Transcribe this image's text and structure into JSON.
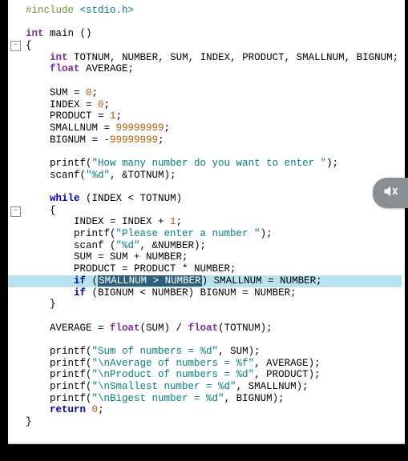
{
  "code": {
    "lines": [
      {
        "indent": 0,
        "tokens": [
          {
            "c": "pp",
            "t": "#include"
          },
          {
            "c": "",
            "t": " "
          },
          {
            "c": "s",
            "t": "<stdio.h>"
          }
        ]
      },
      {
        "indent": 0,
        "tokens": []
      },
      {
        "indent": 0,
        "tokens": [
          {
            "c": "ty",
            "t": "int"
          },
          {
            "c": "",
            "t": " "
          },
          {
            "c": "id",
            "t": "main ()"
          }
        ]
      },
      {
        "indent": 0,
        "tokens": [
          {
            "c": "id",
            "t": "{"
          }
        ]
      },
      {
        "indent": 1,
        "tokens": [
          {
            "c": "ty",
            "t": "int"
          },
          {
            "c": "",
            "t": " "
          },
          {
            "c": "id",
            "t": "TOTNUM, NUMBER, SUM, INDEX, PRODUCT, SMALLNUM, BIGNUM;"
          }
        ]
      },
      {
        "indent": 1,
        "tokens": [
          {
            "c": "ty",
            "t": "float"
          },
          {
            "c": "",
            "t": " "
          },
          {
            "c": "id",
            "t": "AVERAGE;"
          }
        ]
      },
      {
        "indent": 0,
        "tokens": []
      },
      {
        "indent": 1,
        "tokens": [
          {
            "c": "id",
            "t": "SUM = "
          },
          {
            "c": "n",
            "t": "0"
          },
          {
            "c": "id",
            "t": ";"
          }
        ]
      },
      {
        "indent": 1,
        "tokens": [
          {
            "c": "id",
            "t": "INDEX = "
          },
          {
            "c": "n",
            "t": "0"
          },
          {
            "c": "id",
            "t": ";"
          }
        ]
      },
      {
        "indent": 1,
        "tokens": [
          {
            "c": "id",
            "t": "PRODUCT = "
          },
          {
            "c": "n",
            "t": "1"
          },
          {
            "c": "id",
            "t": ";"
          }
        ]
      },
      {
        "indent": 1,
        "tokens": [
          {
            "c": "id",
            "t": "SMALLNUM = "
          },
          {
            "c": "n",
            "t": "99999999"
          },
          {
            "c": "id",
            "t": ";"
          }
        ]
      },
      {
        "indent": 1,
        "tokens": [
          {
            "c": "id",
            "t": "BIGNUM = -"
          },
          {
            "c": "n",
            "t": "99999999"
          },
          {
            "c": "id",
            "t": ";"
          }
        ]
      },
      {
        "indent": 0,
        "tokens": []
      },
      {
        "indent": 1,
        "tokens": [
          {
            "c": "id",
            "t": "printf("
          },
          {
            "c": "s",
            "t": "\"How many number do you want to enter \""
          },
          {
            "c": "id",
            "t": ");"
          }
        ]
      },
      {
        "indent": 1,
        "tokens": [
          {
            "c": "id",
            "t": "scanf("
          },
          {
            "c": "s",
            "t": "\"%d\""
          },
          {
            "c": "id",
            "t": ", &TOTNUM);"
          }
        ]
      },
      {
        "indent": 0,
        "tokens": []
      },
      {
        "indent": 1,
        "tokens": [
          {
            "c": "kw",
            "t": "while"
          },
          {
            "c": "",
            "t": " "
          },
          {
            "c": "id",
            "t": "(INDEX < TOTNUM)"
          }
        ]
      },
      {
        "indent": 1,
        "tokens": [
          {
            "c": "id",
            "t": "{"
          }
        ]
      },
      {
        "indent": 2,
        "tokens": [
          {
            "c": "id",
            "t": "INDEX = INDEX + "
          },
          {
            "c": "n",
            "t": "1"
          },
          {
            "c": "id",
            "t": ";"
          }
        ]
      },
      {
        "indent": 2,
        "tokens": [
          {
            "c": "id",
            "t": "printf("
          },
          {
            "c": "s",
            "t": "\"Please enter a number \""
          },
          {
            "c": "id",
            "t": ");"
          }
        ]
      },
      {
        "indent": 2,
        "tokens": [
          {
            "c": "id",
            "t": "scanf ("
          },
          {
            "c": "s",
            "t": "\"%d\""
          },
          {
            "c": "id",
            "t": ", &NUMBER);"
          }
        ]
      },
      {
        "indent": 2,
        "tokens": [
          {
            "c": "id",
            "t": "SUM = SUM + NUMBER;"
          }
        ]
      },
      {
        "indent": 2,
        "tokens": [
          {
            "c": "id",
            "t": "PRODUCT = PRODUCT * NUMBER;"
          }
        ]
      },
      {
        "indent": 2,
        "hl": true,
        "tokens": [
          {
            "c": "kw",
            "t": "if"
          },
          {
            "c": "",
            "t": " "
          },
          {
            "c": "id",
            "t": "("
          },
          {
            "c": "rev",
            "t": "SMALLNUM > NUMBER"
          },
          {
            "c": "id",
            "t": ") SMALLNUM = NUMBER;"
          }
        ]
      },
      {
        "indent": 2,
        "tokens": [
          {
            "c": "kw",
            "t": "if"
          },
          {
            "c": "",
            "t": " "
          },
          {
            "c": "id",
            "t": "(BIGNUM < NUMBER) BIGNUM = NUMBER;"
          }
        ]
      },
      {
        "indent": 1,
        "tokens": [
          {
            "c": "id",
            "t": "}"
          }
        ]
      },
      {
        "indent": 0,
        "tokens": []
      },
      {
        "indent": 1,
        "tokens": [
          {
            "c": "id",
            "t": "AVERAGE = "
          },
          {
            "c": "ty",
            "t": "float"
          },
          {
            "c": "id",
            "t": "(SUM) / "
          },
          {
            "c": "ty",
            "t": "float"
          },
          {
            "c": "id",
            "t": "(TOTNUM);"
          }
        ]
      },
      {
        "indent": 0,
        "tokens": []
      },
      {
        "indent": 1,
        "tokens": [
          {
            "c": "id",
            "t": "printf("
          },
          {
            "c": "s",
            "t": "\"Sum of numbers = %d\""
          },
          {
            "c": "id",
            "t": ", SUM);"
          }
        ]
      },
      {
        "indent": 1,
        "tokens": [
          {
            "c": "id",
            "t": "printf("
          },
          {
            "c": "s",
            "t": "\"\\nAverage of numbers = %f\""
          },
          {
            "c": "id",
            "t": ", AVERAGE);"
          }
        ]
      },
      {
        "indent": 1,
        "tokens": [
          {
            "c": "id",
            "t": "printf("
          },
          {
            "c": "s",
            "t": "\"\\nProduct of numbers = %d\""
          },
          {
            "c": "id",
            "t": ", PRODUCT);"
          }
        ]
      },
      {
        "indent": 1,
        "tokens": [
          {
            "c": "id",
            "t": "printf("
          },
          {
            "c": "s",
            "t": "\"\\nSmallest number = %d\""
          },
          {
            "c": "id",
            "t": ", SMALLNUM);"
          }
        ]
      },
      {
        "indent": 1,
        "tokens": [
          {
            "c": "id",
            "t": "printf("
          },
          {
            "c": "s",
            "t": "\"\\nBigest number = %d\""
          },
          {
            "c": "id",
            "t": ", BIGNUM);"
          }
        ]
      },
      {
        "indent": 1,
        "tokens": [
          {
            "c": "ret",
            "t": "return"
          },
          {
            "c": "",
            "t": " "
          },
          {
            "c": "n",
            "t": "0"
          },
          {
            "c": "id",
            "t": ";"
          }
        ]
      },
      {
        "indent": 0,
        "tokens": [
          {
            "c": "id",
            "t": "}"
          }
        ]
      }
    ]
  },
  "fold_positions": [
    51,
    258
  ],
  "icon": "speaker-muted-icon"
}
